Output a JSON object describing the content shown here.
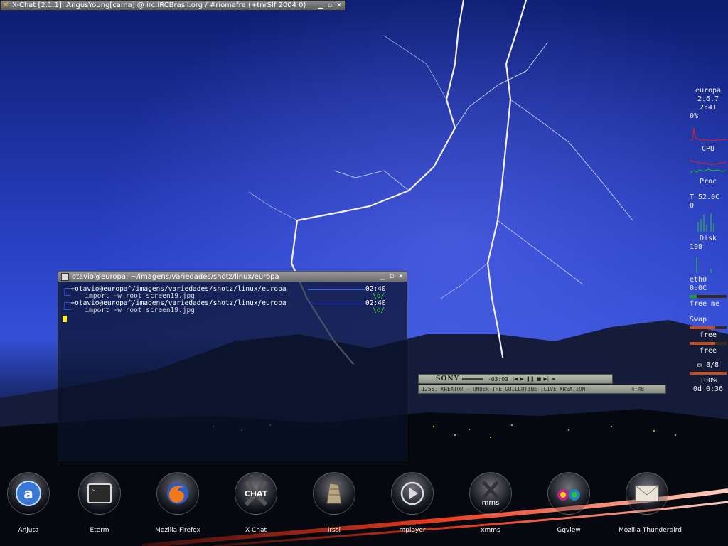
{
  "xchat_window": {
    "title": "X-Chat [2.1.1]: AngusYoung[cama] @ irc.IRCBrasil.org / #riomafra (+tnrSlf 2004 0)"
  },
  "terminal": {
    "title": "otavio@europa: ~/imagens/variedades/shotz/linux/europa",
    "lines": [
      {
        "prompt": "+otavio@europa^/imagens/variedades/shotz/linux/europa",
        "time": "02:40",
        "smile": "\\o/",
        "command": "import -w root screen19.jpg"
      },
      {
        "prompt": "+otavio@europa^/imagens/variedades/shotz/linux/europa",
        "time": "02:40",
        "smile": "\\o/",
        "command": "import -w root screen19.jpg"
      }
    ]
  },
  "xmms": {
    "logo": "SONY",
    "time": "-03:03",
    "track": "1255. KREATOR - UNDER THE GUILLOTINE (LIVE KREATION)",
    "length": "4:48"
  },
  "gkrellm": {
    "hostname": "europa",
    "kernel": "2.6.7",
    "clock": "2:41",
    "cpu_percent": "0%",
    "cpu_label": "CPU",
    "proc_label": "Proc",
    "temp_label": "T 52.0C",
    "proc_count": "0",
    "disk_label": "Disk",
    "disk_value": "198",
    "net_label": "eth0",
    "net_value": "0:0C",
    "mem_label": "free me",
    "swap_label": "Swap",
    "free_label_1": "free",
    "free_label_2": "free",
    "mail_count": "8/8",
    "battery": "100%",
    "uptime": "0d 0:36"
  },
  "dock": {
    "items": [
      {
        "label": "Anjuta",
        "icon": "anjuta-icon"
      },
      {
        "label": "Eterm",
        "icon": "terminal-icon"
      },
      {
        "label": "Mozilla Firefox",
        "icon": "firefox-icon"
      },
      {
        "label": "X-Chat",
        "icon": "xchat-icon"
      },
      {
        "label": "irssi",
        "icon": "irssi-icon"
      },
      {
        "label": "mplayer",
        "icon": "play-icon"
      },
      {
        "label": "xmms",
        "icon": "xmms-icon"
      },
      {
        "label": "Gqview",
        "icon": "binoculars-icon"
      },
      {
        "label": "Mozilla Thunderbird",
        "icon": "envelope-icon"
      }
    ],
    "icon_glyphs": {
      "xchat": "CHAT",
      "xmms": "mms",
      "anjuta": "a"
    }
  },
  "colors": {
    "sky_top": "#0d1f7a",
    "sky_mid": "#2a44c8",
    "lightning": "#f4f0ff",
    "ground": "#05070d",
    "terminal_prompt_accent": "#3c5cff",
    "smiley": "#44dd44",
    "cursor": "#ffee22"
  }
}
